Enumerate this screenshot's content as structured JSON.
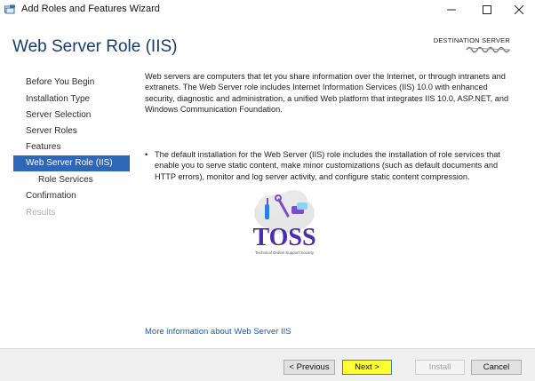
{
  "window": {
    "title": "Add Roles and Features Wizard",
    "controls": [
      "minimize-icon",
      "maximize-icon",
      "close-icon"
    ]
  },
  "header": {
    "page_title": "Web Server Role (IIS)",
    "destination_label": "DESTINATION SERVER"
  },
  "sidebar": {
    "items": [
      {
        "label": "Before You Begin",
        "state": "normal"
      },
      {
        "label": "Installation Type",
        "state": "normal"
      },
      {
        "label": "Server Selection",
        "state": "normal"
      },
      {
        "label": "Server Roles",
        "state": "normal"
      },
      {
        "label": "Features",
        "state": "normal"
      },
      {
        "label": "Web Server Role (IIS)",
        "state": "active"
      },
      {
        "label": "Role Services",
        "state": "sub"
      },
      {
        "label": "Confirmation",
        "state": "normal"
      },
      {
        "label": "Results",
        "state": "disabled"
      }
    ]
  },
  "content": {
    "intro": "Web servers are computers that let you share information over the Internet, or through intranets and extranets. The Web Server role includes Internet Information Services (IIS) 10.0 with enhanced security, diagnostic and administration, a unified Web platform that integrates IIS 10.0, ASP.NET, and Windows Communication Foundation.",
    "bullet": "The default installation for the Web Server (IIS) role includes the installation of role services that enable you to serve static content, make minor customizations (such as default documents and HTTP errors), monitor and log server activity, and configure static content compression.",
    "more_link": "More information about Web Server IIS"
  },
  "watermark": {
    "text": "TOSS",
    "tagline": "Technical Online Support Society"
  },
  "footer": {
    "previous": "< Previous",
    "next": "Next >",
    "install": "Install",
    "cancel": "Cancel"
  },
  "colors": {
    "title_blue": "#1a3a6e",
    "active_nav": "#2e67b8",
    "link": "#1a5fb4",
    "next_highlight": "#ffff33"
  }
}
